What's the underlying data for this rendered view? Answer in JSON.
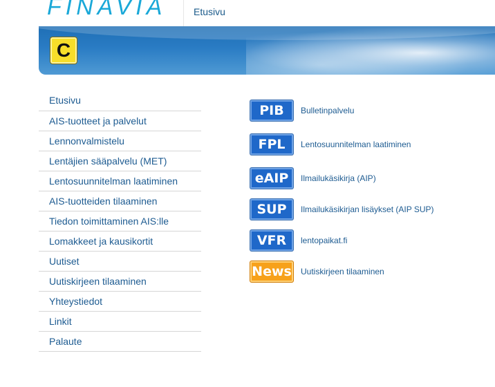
{
  "header": {
    "logo": "FINAVIA",
    "breadcrumb": "Etusivu",
    "banner_icon": "C"
  },
  "nav": {
    "items": [
      {
        "label": "Etusivu"
      },
      {
        "label": "AIS-tuotteet ja palvelut"
      },
      {
        "label": "Lennonvalmistelu"
      },
      {
        "label": "Lentäjien sääpalvelu (MET)"
      },
      {
        "label": "Lentosuunnitelman laatiminen"
      },
      {
        "label": "AIS-tuotteiden tilaaminen"
      },
      {
        "label": "Tiedon toimittaminen AIS:lle"
      },
      {
        "label": "Lomakkeet ja kausikortit"
      },
      {
        "label": "Uutiset"
      },
      {
        "label": "Uutiskirjeen tilaaminen"
      },
      {
        "label": "Yhteystiedot"
      },
      {
        "label": "Linkit"
      },
      {
        "label": "Palaute"
      }
    ]
  },
  "services": [
    {
      "badge": "PIB",
      "label": "Bulletinpalvelu",
      "color": "#1f68c9"
    },
    {
      "badge": "FPL",
      "label": "Lentosuunnitelman laatiminen",
      "color": "#1f68c9"
    },
    {
      "badge": "eAIP",
      "label": "Ilmailukäsikirja (AIP)",
      "color": "#1f68c9"
    },
    {
      "badge": "SUP",
      "label": "Ilmailukäsikirjan lisäykset (AIP SUP)",
      "color": "#1f68c9"
    },
    {
      "badge": "VFR",
      "label": "lentopaikat.fi",
      "color": "#1f68c9"
    },
    {
      "badge": "News",
      "label": "Uutiskirjeen tilaaminen",
      "color": "#f7a11a"
    }
  ],
  "colors": {
    "brand": "#1aa8d8",
    "link": "#1d5b91",
    "banner": "#1f6fb5"
  }
}
